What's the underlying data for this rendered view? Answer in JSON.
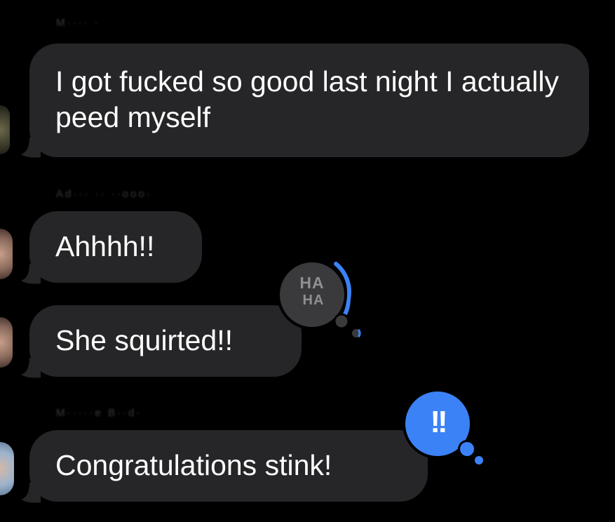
{
  "conversation": {
    "messages": [
      {
        "sender": "M···· ·",
        "text": "I got fucked so good last night I actually peed myself"
      },
      {
        "sender": "Ad··· ·· ··ooo·",
        "text": "Ahhhh!!"
      },
      {
        "text": "She squirted!!",
        "reaction": {
          "icon": "haha-reaction-icon",
          "label_top": "HA",
          "label_bottom": "HA"
        }
      },
      {
        "sender": "M·····e B··d·",
        "text": "Congratulations stink!",
        "reaction": {
          "icon": "exclamation-reaction-icon",
          "label": "!!"
        }
      }
    ]
  },
  "colors": {
    "background": "#000000",
    "bubble": "#262628",
    "reaction_haha_bg": "#3a3a3c",
    "reaction_accent": "#3b82f6"
  }
}
